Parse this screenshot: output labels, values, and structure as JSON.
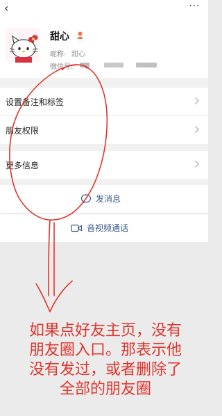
{
  "topbar": {
    "back_icon": "‹",
    "more_icon": "···"
  },
  "profile": {
    "nickname": "甜心",
    "alias_label": "昵称: ",
    "alias_value": "甜心",
    "wechat_label": "微信号: "
  },
  "menu": [
    {
      "label": "设置备注和标签"
    },
    {
      "label": "朋友权限"
    },
    {
      "label": "更多信息"
    }
  ],
  "actions": {
    "message_label": "发消息",
    "video_call_label": "音视频通话"
  },
  "annotation": {
    "line1": "如果点好友主页，没有",
    "line2": "朋友圈入口。那表示他",
    "line3": "没有发过，或者删除了",
    "line4": "全部的朋友圈",
    "color": "#e0352d"
  }
}
